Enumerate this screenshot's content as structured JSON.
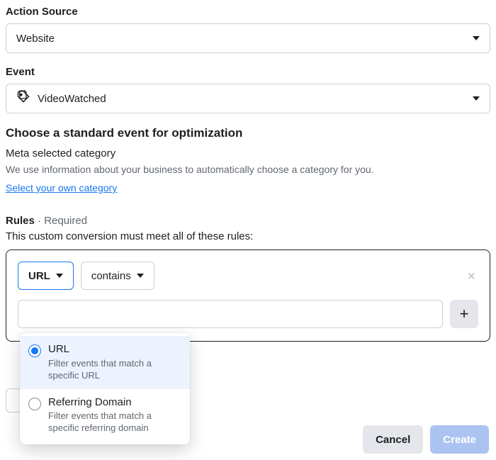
{
  "actionSource": {
    "label": "Action Source",
    "value": "Website"
  },
  "event": {
    "label": "Event",
    "value": "VideoWatched"
  },
  "optimization": {
    "heading": "Choose a standard event for optimization",
    "subheading": "Meta selected category",
    "description": "We use information about your business to automatically choose a category for you.",
    "link": "Select your own category"
  },
  "rules": {
    "label": "Rules",
    "required": " · Required",
    "description": "This custom conversion must meet all of these rules:",
    "pill_url": "URL",
    "pill_contains": "contains",
    "input_value": "",
    "add_label": "+"
  },
  "urlDropdown": {
    "items": [
      {
        "title": "URL",
        "sub": "Filter events that match a specific URL",
        "selected": true
      },
      {
        "title": "Referring Domain",
        "sub": "Filter events that match a specific referring domain",
        "selected": false
      }
    ]
  },
  "footer": {
    "cancel": "Cancel",
    "create": "Create"
  }
}
